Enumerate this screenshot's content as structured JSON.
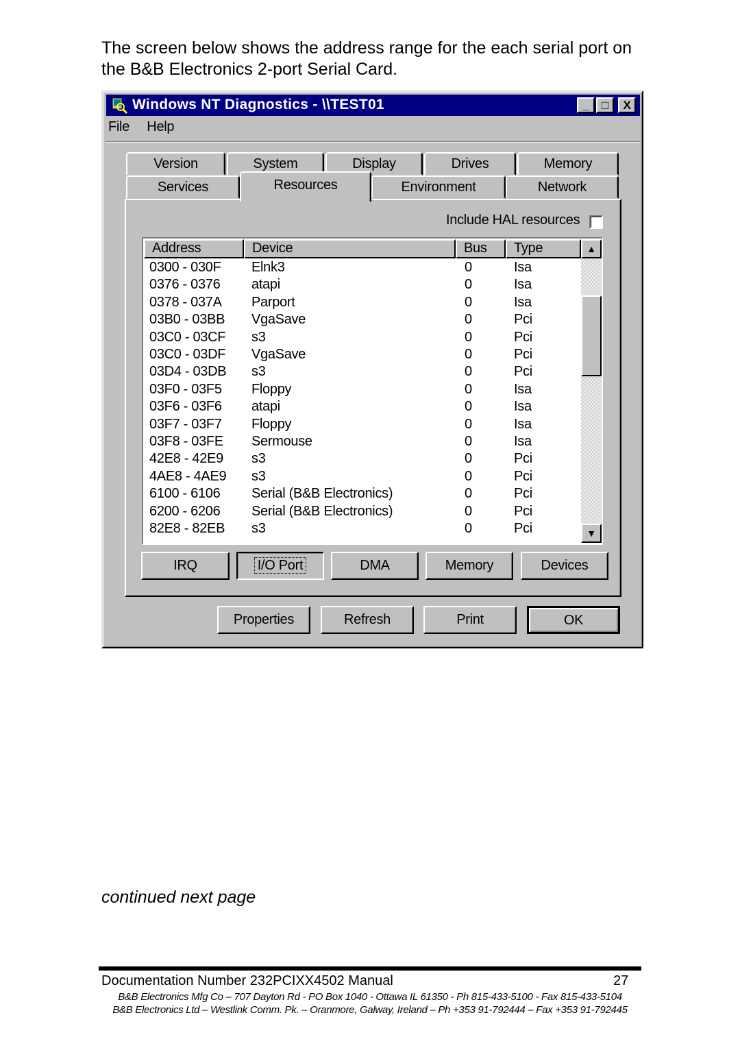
{
  "intro_text": "The screen below shows the address range for the each serial port on the B&B Electronics 2-port Serial Card.",
  "window": {
    "title": "Windows NT Diagnostics - \\\\TEST01",
    "title_bar_color": "#000080",
    "controls": {
      "minimize": "_",
      "maximize": "□",
      "close": "X"
    },
    "menu": [
      "File",
      "Help"
    ],
    "tabs_row1": [
      "Version",
      "System",
      "Display",
      "Drives",
      "Memory"
    ],
    "tabs_row2": [
      "Services",
      "Resources",
      "Environment",
      "Network"
    ],
    "active_tab": "Resources",
    "include_hal_label": "Include HAL resources",
    "include_hal_checked": false,
    "list": {
      "columns": [
        "Address",
        "Device",
        "Bus",
        "Type"
      ],
      "rows": [
        [
          "0300 - 030F",
          "Elnk3",
          "0",
          "Isa"
        ],
        [
          "0376 - 0376",
          "atapi",
          "0",
          "Isa"
        ],
        [
          "0378 - 037A",
          "Parport",
          "0",
          "Isa"
        ],
        [
          "03B0 - 03BB",
          "VgaSave",
          "0",
          "Pci"
        ],
        [
          "03C0 - 03CF",
          "s3",
          "0",
          "Pci"
        ],
        [
          "03C0 - 03DF",
          "VgaSave",
          "0",
          "Pci"
        ],
        [
          "03D4 - 03DB",
          "s3",
          "0",
          "Pci"
        ],
        [
          "03F0 - 03F5",
          "Floppy",
          "0",
          "Isa"
        ],
        [
          "03F6 - 03F6",
          "atapi",
          "0",
          "Isa"
        ],
        [
          "03F7 - 03F7",
          "Floppy",
          "0",
          "Isa"
        ],
        [
          "03F8 - 03FE",
          "Sermouse",
          "0",
          "Isa"
        ],
        [
          "42E8 - 42E9",
          "s3",
          "0",
          "Pci"
        ],
        [
          "4AE8 - 4AE9",
          "s3",
          "0",
          "Pci"
        ],
        [
          "6100 - 6106",
          "Serial (B&B Electronics)",
          "0",
          "Pci"
        ],
        [
          "6200 - 6206",
          "Serial (B&B Electronics)",
          "0",
          "Pci"
        ],
        [
          "82E8 - 82EB",
          "s3",
          "0",
          "Pci"
        ]
      ]
    },
    "resource_buttons": [
      "IRQ",
      "I/O Port",
      "DMA",
      "Memory",
      "Devices"
    ],
    "selected_resource": "I/O Port",
    "action_buttons": [
      "Properties",
      "Refresh",
      "Print",
      "OK"
    ]
  },
  "continued": "continued next page",
  "footer": {
    "doc_number": "Documentation Number 232PCIXX4502 Manual",
    "page": "27",
    "address1": "B&B Electronics Mfg Co – 707 Dayton Rd - PO Box 1040 - Ottawa IL 61350 - Ph 815-433-5100 - Fax 815-433-5104",
    "address2": "B&B Electronics Ltd – Westlink Comm. Pk. – Oranmore, Galway, Ireland – Ph +353 91-792444 – Fax +353 91-792445"
  }
}
